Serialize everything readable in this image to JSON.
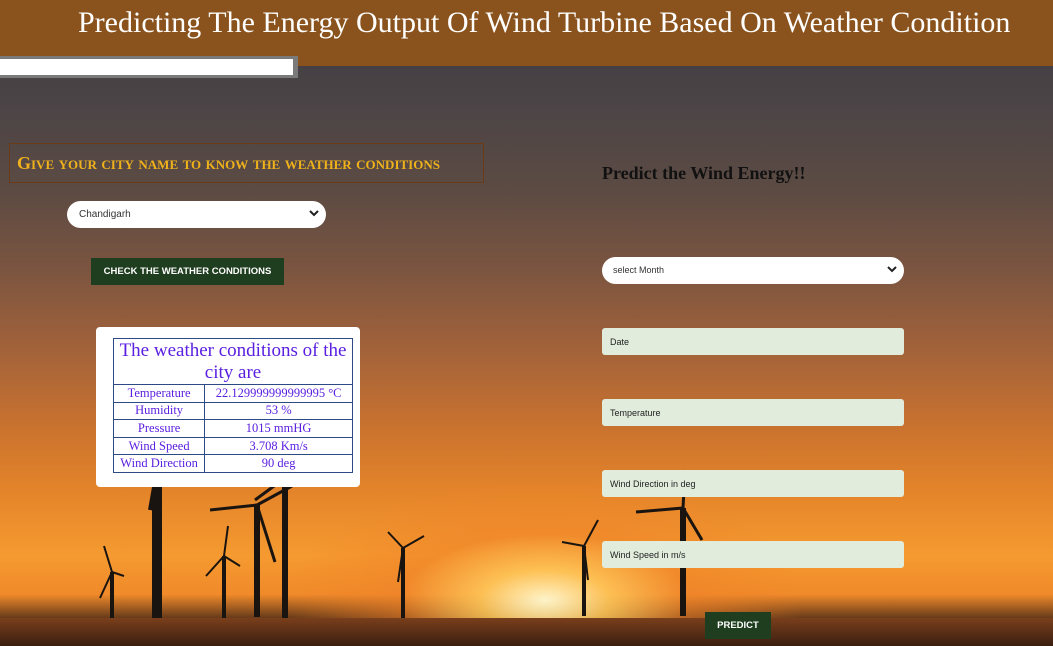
{
  "header": {
    "title": "Predicting The Energy Output Of Wind Turbine Based On Weather Condition"
  },
  "left_panel": {
    "heading": "Give your city name to know the weather conditions",
    "city_select_value": "Chandigarh",
    "check_button_label": "CHECK THE WEATHER CONDITIONS",
    "weather_card": {
      "caption": "The weather conditions of the city are",
      "rows": [
        {
          "label": "Temperature",
          "value": "22.129999999999995 °C"
        },
        {
          "label": "Humidity",
          "value": "53 %"
        },
        {
          "label": "Pressure",
          "value": "1015 mmHG"
        },
        {
          "label": "Wind Speed",
          "value": "3.708 Km/s"
        },
        {
          "label": "Wind Direction",
          "value": "90 deg"
        }
      ]
    }
  },
  "right_panel": {
    "heading": "Predict the Wind Energy!!",
    "month_select_placeholder": "select Month",
    "fields": {
      "date_placeholder": "Date",
      "temperature_placeholder": "Temperature",
      "wind_direction_placeholder": "Wind Direction in deg",
      "wind_speed_placeholder": "Wind Speed in m/s"
    },
    "predict_button_label": "PREDICT"
  },
  "colors": {
    "header_bg": "#8a531d",
    "heading_gold": "#f0b21b",
    "button_green": "#1f3d1f",
    "input_bg": "#e1ecdc",
    "table_text": "#5a1fe0"
  },
  "icons": [
    "chevron-down-icon"
  ]
}
